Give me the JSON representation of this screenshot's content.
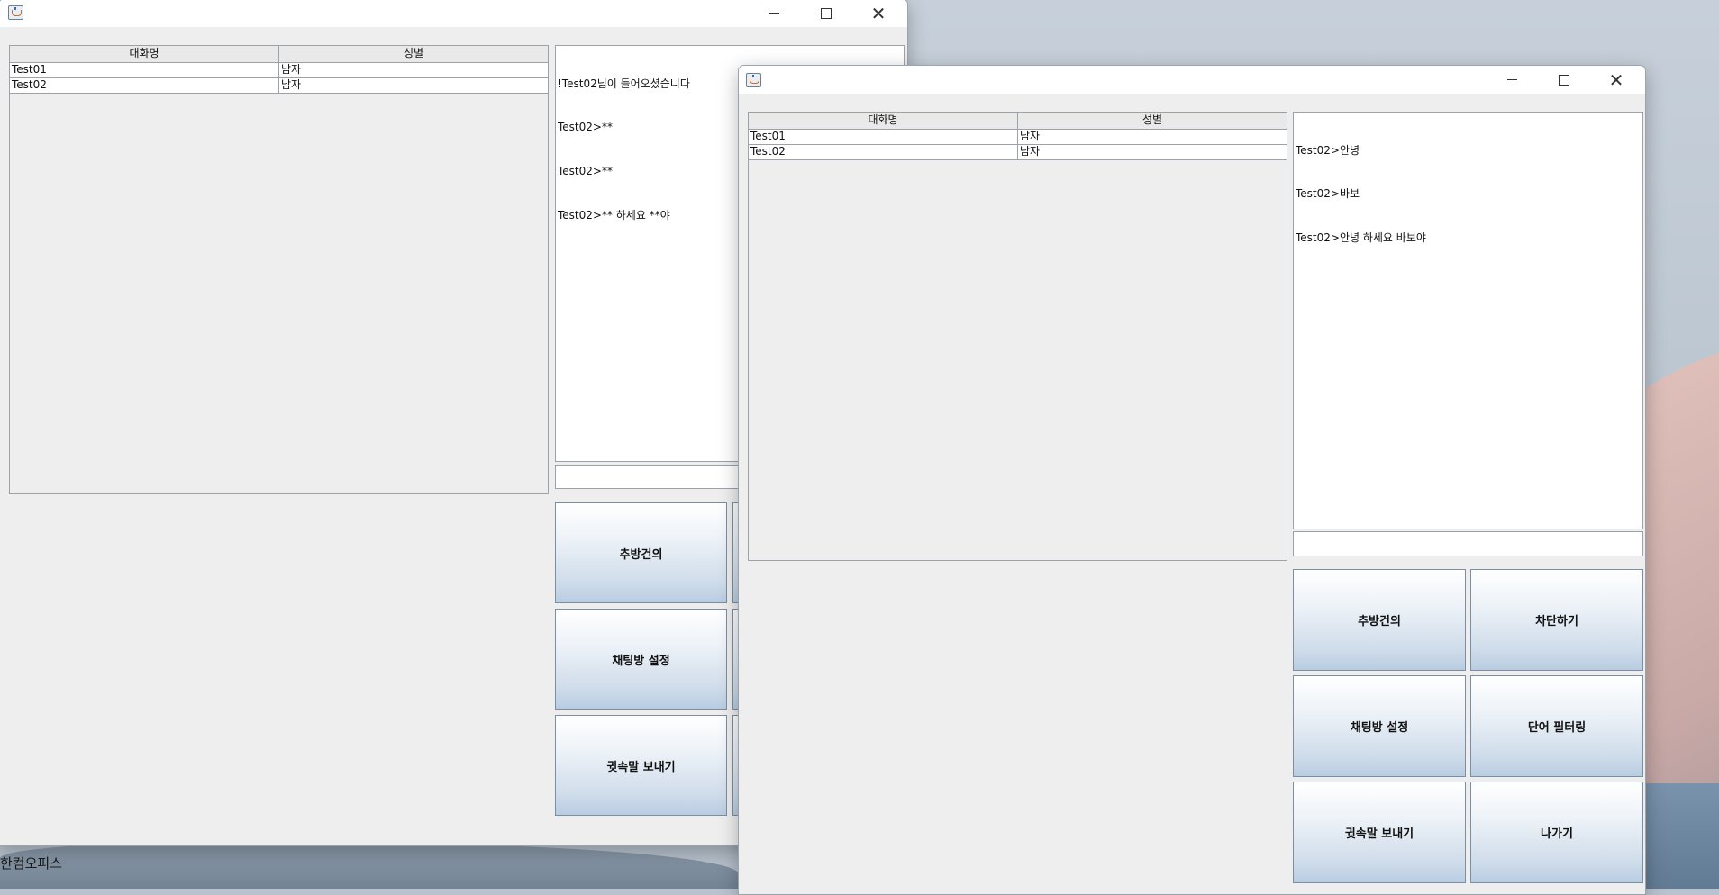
{
  "desktop": {
    "taskbar_label": "한컴오피스"
  },
  "window_back": {
    "table": {
      "columns": [
        "대화명",
        "성별"
      ],
      "rows": [
        [
          "Test01",
          "남자"
        ],
        [
          "Test02",
          "남자"
        ]
      ]
    },
    "chat": {
      "lines": [
        "!Test02님이 들어오셨습니다",
        "Test02>**",
        "Test02>**",
        "Test02>** 하세요 **야"
      ]
    },
    "input_value": "",
    "buttons": {
      "vote_kick": "추방건의",
      "room_settings": "채팅방 설정",
      "whisper": "귓속말 보내기"
    }
  },
  "window_front": {
    "table": {
      "columns": [
        "대화명",
        "성별"
      ],
      "rows": [
        [
          "Test01",
          "남자"
        ],
        [
          "Test02",
          "남자"
        ]
      ]
    },
    "chat": {
      "lines": [
        "Test02>안녕",
        "Test02>바보",
        "Test02>안녕 하세요 바보야"
      ]
    },
    "input_value": "",
    "buttons": {
      "vote_kick": "추방건의",
      "block": "차단하기",
      "room_settings": "채팅방 설정",
      "word_filter": "단어 필터링",
      "whisper": "귓속말 보내기",
      "exit": "나가기"
    }
  }
}
